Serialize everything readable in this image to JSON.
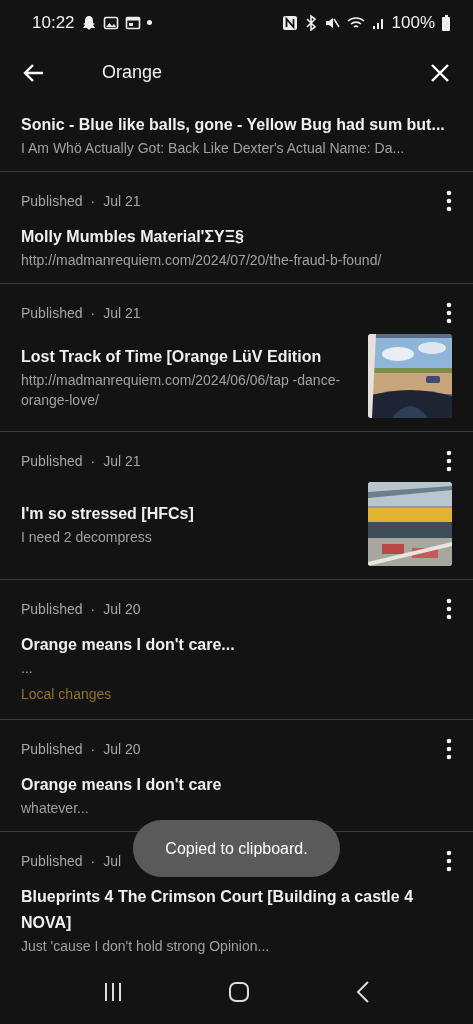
{
  "status_bar": {
    "time": "10:22",
    "battery": "100%"
  },
  "header": {
    "title": "Orange"
  },
  "posts": [
    {
      "title": "Sonic - Blue like balls, gone - Yellow Bug had sum but...",
      "excerpt": "I Am Whö Actually Got: Back Like Dexter's Actual Name: Da..."
    },
    {
      "status": "Published",
      "separator": "·",
      "date": "Jul 21",
      "title": "Molly Mumbles Material'ΣΥΞ§",
      "excerpt": "http://madmanrequiem.com/2024/07/20/the-fraud-b-found/"
    },
    {
      "status": "Published",
      "separator": "·",
      "date": "Jul 21",
      "title": "Lost Track of Time [Orange LüV Edition",
      "excerpt": "http://madmanrequiem.com/2024/06/06/tap -dance-orange-love/",
      "thumbnail": {
        "kind": "car"
      }
    },
    {
      "status": "Published",
      "separator": "·",
      "date": "Jul 21",
      "title": "I'm so stressed [HFCs]",
      "excerpt": "I need 2 decompress",
      "thumbnail": {
        "kind": "grid"
      }
    },
    {
      "status": "Published",
      "separator": "·",
      "date": "Jul 20",
      "title": "Orange means I don't care...",
      "excerpt": "...",
      "note": "Local changes"
    },
    {
      "status": "Published",
      "separator": "·",
      "date": "Jul 20",
      "title": "Orange means I don't care",
      "excerpt": "whatever..."
    },
    {
      "status": "Published",
      "separator": "·",
      "date": "Jul",
      "title": "Blueprints 4 The Crimson Court [Building a castle 4 NOVA]",
      "excerpt": "Just 'cause I don't hold strong Opinion..."
    }
  ],
  "toast": "Copied to clipboard."
}
